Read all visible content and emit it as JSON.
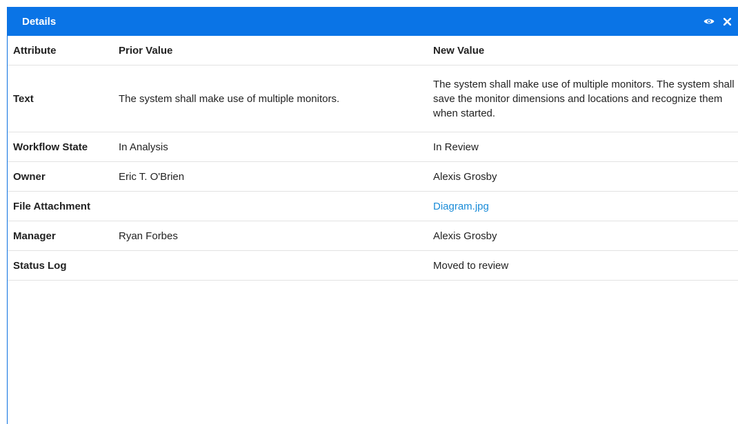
{
  "panel": {
    "title": "Details"
  },
  "icons": {
    "view": "eye-icon",
    "close": "close-icon"
  },
  "colors": {
    "titlebar": "#0a74e6",
    "link": "#1a8cd8"
  },
  "table": {
    "headers": {
      "attribute": "Attribute",
      "prior": "Prior Value",
      "new": "New Value"
    },
    "rows": [
      {
        "attribute": "Text",
        "prior": "The system shall make use of multiple monitors.",
        "new": "The system shall make use of multiple monitors. The system shall save the monitor dimensions and locations and recognize them when started."
      },
      {
        "attribute": "Workflow State",
        "prior": "In Analysis",
        "new": "In Review"
      },
      {
        "attribute": "Owner",
        "prior": "Eric T. O'Brien",
        "new": "Alexis Grosby"
      },
      {
        "attribute": "File Attachment",
        "prior": "",
        "new": "Diagram.jpg"
      },
      {
        "attribute": "Manager",
        "prior": "Ryan Forbes",
        "new": "Alexis Grosby"
      },
      {
        "attribute": "Status Log",
        "prior": "",
        "new": "Moved to review"
      }
    ]
  }
}
